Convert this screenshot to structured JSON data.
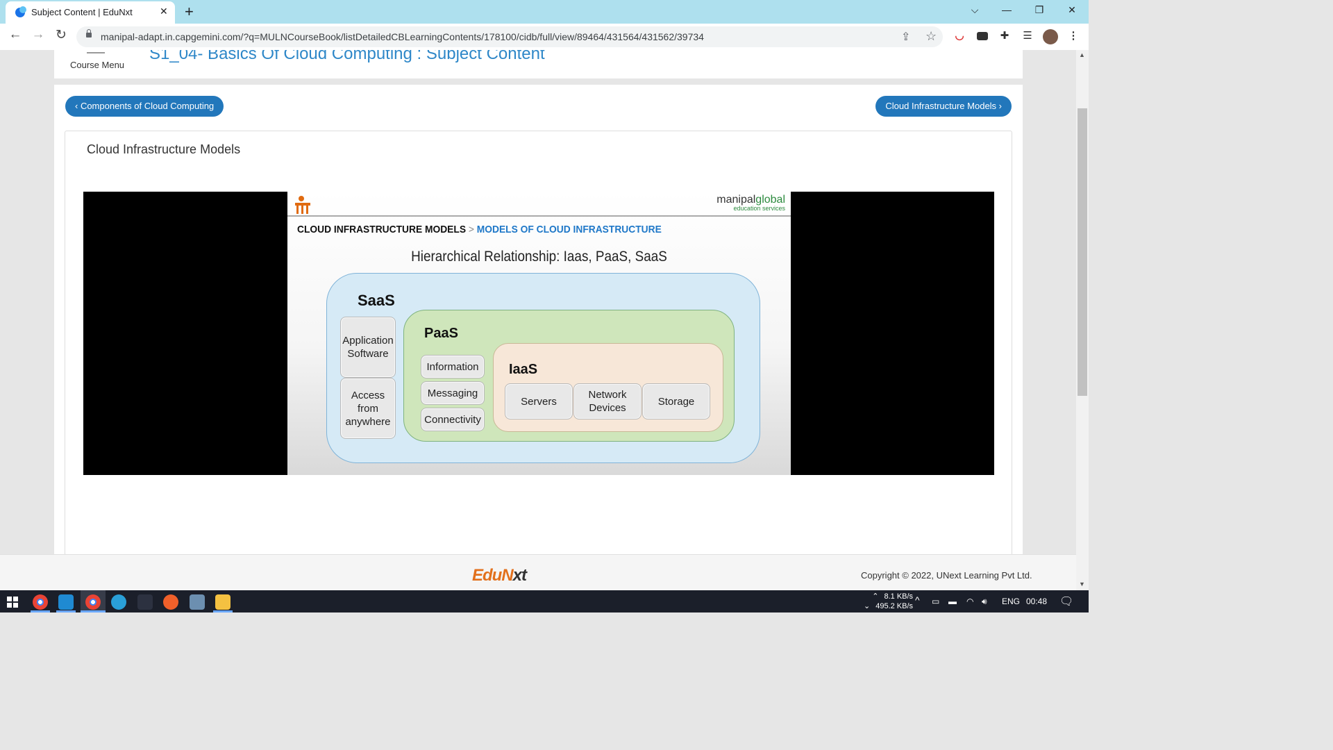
{
  "browser": {
    "tab_title": "Subject Content | EduNxt",
    "url": "manipal-adapt.in.capgemini.com/?q=MULNCourseBook/listDetailedCBLearningContents/178100/cidb/full/view/89464/431564/431562/39734"
  },
  "header": {
    "course_menu_label": "Course Menu",
    "page_title": "S1_04- Basics Of Cloud Computing : Subject Content"
  },
  "nav": {
    "prev_label": "‹ Components of Cloud Computing",
    "next_label": "Cloud Infrastructure Models ›"
  },
  "lesson": {
    "title": "Cloud Infrastructure Models"
  },
  "slide": {
    "brand_name_part1": "manipal",
    "brand_name_part2": "global",
    "brand_sub": "education services",
    "crumb_section": "CLOUD INFRASTRUCTURE MODELS",
    "crumb_separator": ">",
    "crumb_current": "MODELS OF CLOUD INFRASTRUCTURE",
    "heading": "Hierarchical Relationship: Iaas, PaaS, SaaS",
    "saas": {
      "label": "SaaS",
      "items": [
        "Application Software",
        "Access from anywhere"
      ]
    },
    "paas": {
      "label": "PaaS",
      "items": [
        "Information",
        "Messaging",
        "Connectivity"
      ]
    },
    "iaas": {
      "label": "IaaS",
      "items": [
        "Servers",
        "Network Devices",
        "Storage"
      ]
    }
  },
  "footer": {
    "logo_part1": "EduN",
    "logo_part2": "xt",
    "copyright": "Copyright © 2022, UNext Learning Pvt Ltd."
  },
  "taskbar": {
    "upload_speed": "8.1 KB/s",
    "download_speed": "495.2 KB/s",
    "language": "ENG",
    "time": "00:48"
  },
  "colors": {
    "accent": "#2277bb",
    "title_blue": "#2e87c8",
    "saas_fill": "#d6eaf6",
    "paas_fill": "#cfe6bb",
    "iaas_fill": "#f7e7d8",
    "brand_orange": "#e2701c"
  },
  "icons": [
    "edunxt-favicon",
    "close-icon",
    "plus-icon",
    "chevron-down-icon",
    "minimize-icon",
    "restore-icon",
    "back-arrow-icon",
    "forward-arrow-icon",
    "reload-icon",
    "lock-icon",
    "share-icon",
    "star-icon",
    "extension-puzzle-icon",
    "reading-list-icon",
    "profile-avatar",
    "menu-dots-icon",
    "hamburger-icon",
    "windows-start-icon"
  ]
}
